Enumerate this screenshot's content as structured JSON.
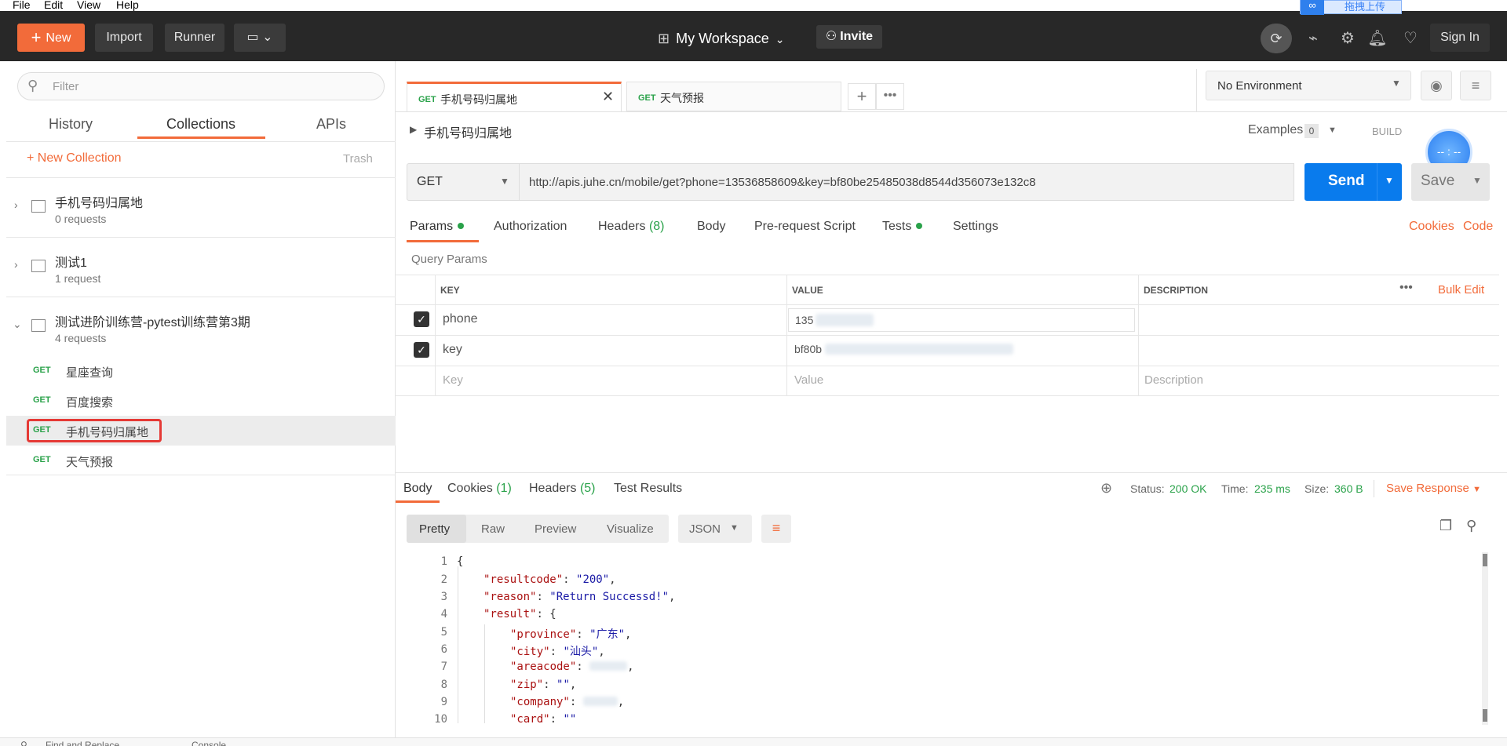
{
  "menu": {
    "file": "File",
    "edit": "Edit",
    "view": "View",
    "help": "Help"
  },
  "header": {
    "new_label": "New",
    "import_label": "Import",
    "runner_label": "Runner",
    "workspace": "My Workspace",
    "invite": "Invite",
    "sign_in": "Sign In",
    "overlay_btn": "拖拽上传"
  },
  "sidebar": {
    "filter_placeholder": "Filter",
    "tabs": [
      "History",
      "Collections",
      "APIs"
    ],
    "new_collection": "+ New Collection",
    "trash": "Trash",
    "collections": [
      {
        "name": "手机号码归属地",
        "count": "0 requests"
      },
      {
        "name": "测试1",
        "count": "1 request"
      },
      {
        "name": "测试进阶训练营-pytest训练营第3期",
        "count": "4 requests"
      }
    ],
    "requests": [
      {
        "method": "GET",
        "name": "星座查询"
      },
      {
        "method": "GET",
        "name": "百度搜索"
      },
      {
        "method": "GET",
        "name": "手机号码归属地"
      },
      {
        "method": "GET",
        "name": "天气预报"
      }
    ]
  },
  "main": {
    "tabs": [
      {
        "method": "GET",
        "name": "手机号码归属地"
      },
      {
        "method": "GET",
        "name": "天气预报"
      }
    ],
    "environment": "No Environment",
    "request_title": "手机号码归属地",
    "examples_label": "Examples",
    "examples_count": "0",
    "build_label": "BUILD",
    "method": "GET",
    "url": "http://apis.juhe.cn/mobile/get?phone=13536858609&key=bf80be25485038d8544d356073e132c8",
    "send": "Send",
    "save": "Save",
    "req_tabs": {
      "params": "Params",
      "authorization": "Authorization",
      "headers": "Headers",
      "headers_count": "(8)",
      "body": "Body",
      "prerequest": "Pre-request Script",
      "tests": "Tests",
      "settings": "Settings"
    },
    "cookies": "Cookies",
    "code": "Code",
    "query_params": "Query Params",
    "columns": {
      "key": "KEY",
      "value": "VALUE",
      "description": "DESCRIPTION",
      "bulk_edit": "Bulk Edit"
    },
    "params": [
      {
        "key": "phone",
        "value": "135"
      },
      {
        "key": "key",
        "value": "bf80b"
      }
    ],
    "placeholder_key": "Key",
    "placeholder_value": "Value",
    "placeholder_desc": "Description",
    "resp_tabs": {
      "body": "Body",
      "cookies": "Cookies",
      "cookies_count": "(1)",
      "headers": "Headers",
      "headers_count": "(5)",
      "tests": "Test Results"
    },
    "status_label": "Status:",
    "status": "200 OK",
    "time_label": "Time:",
    "time": "235 ms",
    "size_label": "Size:",
    "size": "360 B",
    "save_response": "Save Response",
    "view_tabs": [
      "Pretty",
      "Raw",
      "Preview",
      "Visualize"
    ],
    "format": "JSON",
    "code_lines": [
      {
        "n": "1",
        "t": "{"
      },
      {
        "n": "2",
        "k": "\"resultcode\"",
        "v": "\"200\""
      },
      {
        "n": "3",
        "k": "\"reason\"",
        "v": "\"Return Successd!\""
      },
      {
        "n": "4",
        "k": "\"result\"",
        "v": "{"
      },
      {
        "n": "5",
        "k": "\"province\"",
        "v": "\"广东\""
      },
      {
        "n": "6",
        "k": "\"city\"",
        "v": "\"汕头\""
      },
      {
        "n": "7",
        "k": "\"areacode\"",
        "v": ""
      },
      {
        "n": "8",
        "k": "\"zip\"",
        "v": "\"\""
      },
      {
        "n": "9",
        "k": "\"company\"",
        "v": "\"\""
      },
      {
        "n": "10",
        "k": "\"card\"",
        "v": "\"\""
      }
    ],
    "bottom": {
      "find": "Find and Replace",
      "console": "Console"
    }
  },
  "colors": {
    "accent": "#f26b3a",
    "send": "#097bed",
    "green": "#2aa24a",
    "header_bg": "#282828"
  }
}
